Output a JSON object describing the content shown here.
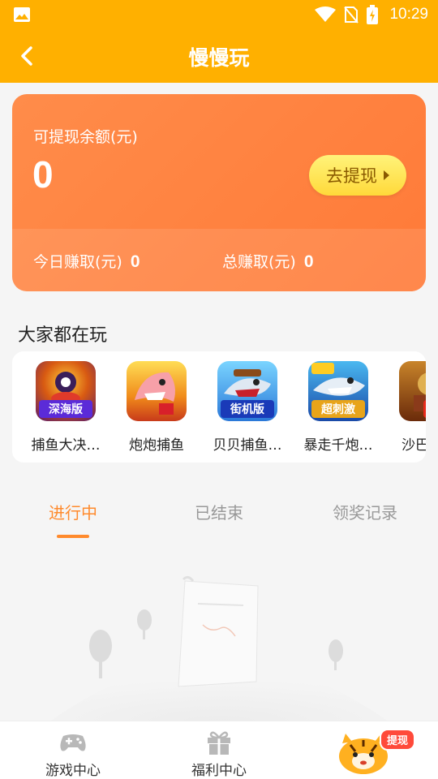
{
  "status_bar": {
    "time": "10:29"
  },
  "header": {
    "title": "慢慢玩"
  },
  "balance_card": {
    "label": "可提现余额(元)",
    "amount": "0",
    "withdraw_label": "去提现",
    "today_label": "今日赚取(元)",
    "today_value": "0",
    "total_label": "总赚取(元)",
    "total_value": "0"
  },
  "popular": {
    "title": "大家都在玩",
    "games": [
      {
        "name": "捕鱼大决…",
        "badge": "深海版"
      },
      {
        "name": "炮炮捕鱼",
        "badge": ""
      },
      {
        "name": "贝贝捕鱼…",
        "badge": "街机版"
      },
      {
        "name": "暴走千炮…",
        "badge": "超刺激"
      },
      {
        "name": "沙巴克…",
        "badge": "红"
      }
    ]
  },
  "tabs": [
    "进行中",
    "已结束",
    "领奖记录"
  ],
  "bottom_nav": {
    "items": [
      {
        "label": "游戏中心",
        "icon": "gamepad-icon"
      },
      {
        "label": "福利中心",
        "icon": "gift-icon"
      }
    ],
    "mascot_tag": "提现"
  },
  "colors": {
    "primary": "#ffb000",
    "accent": "#ff8a2c",
    "card": "#ff7f3f"
  }
}
